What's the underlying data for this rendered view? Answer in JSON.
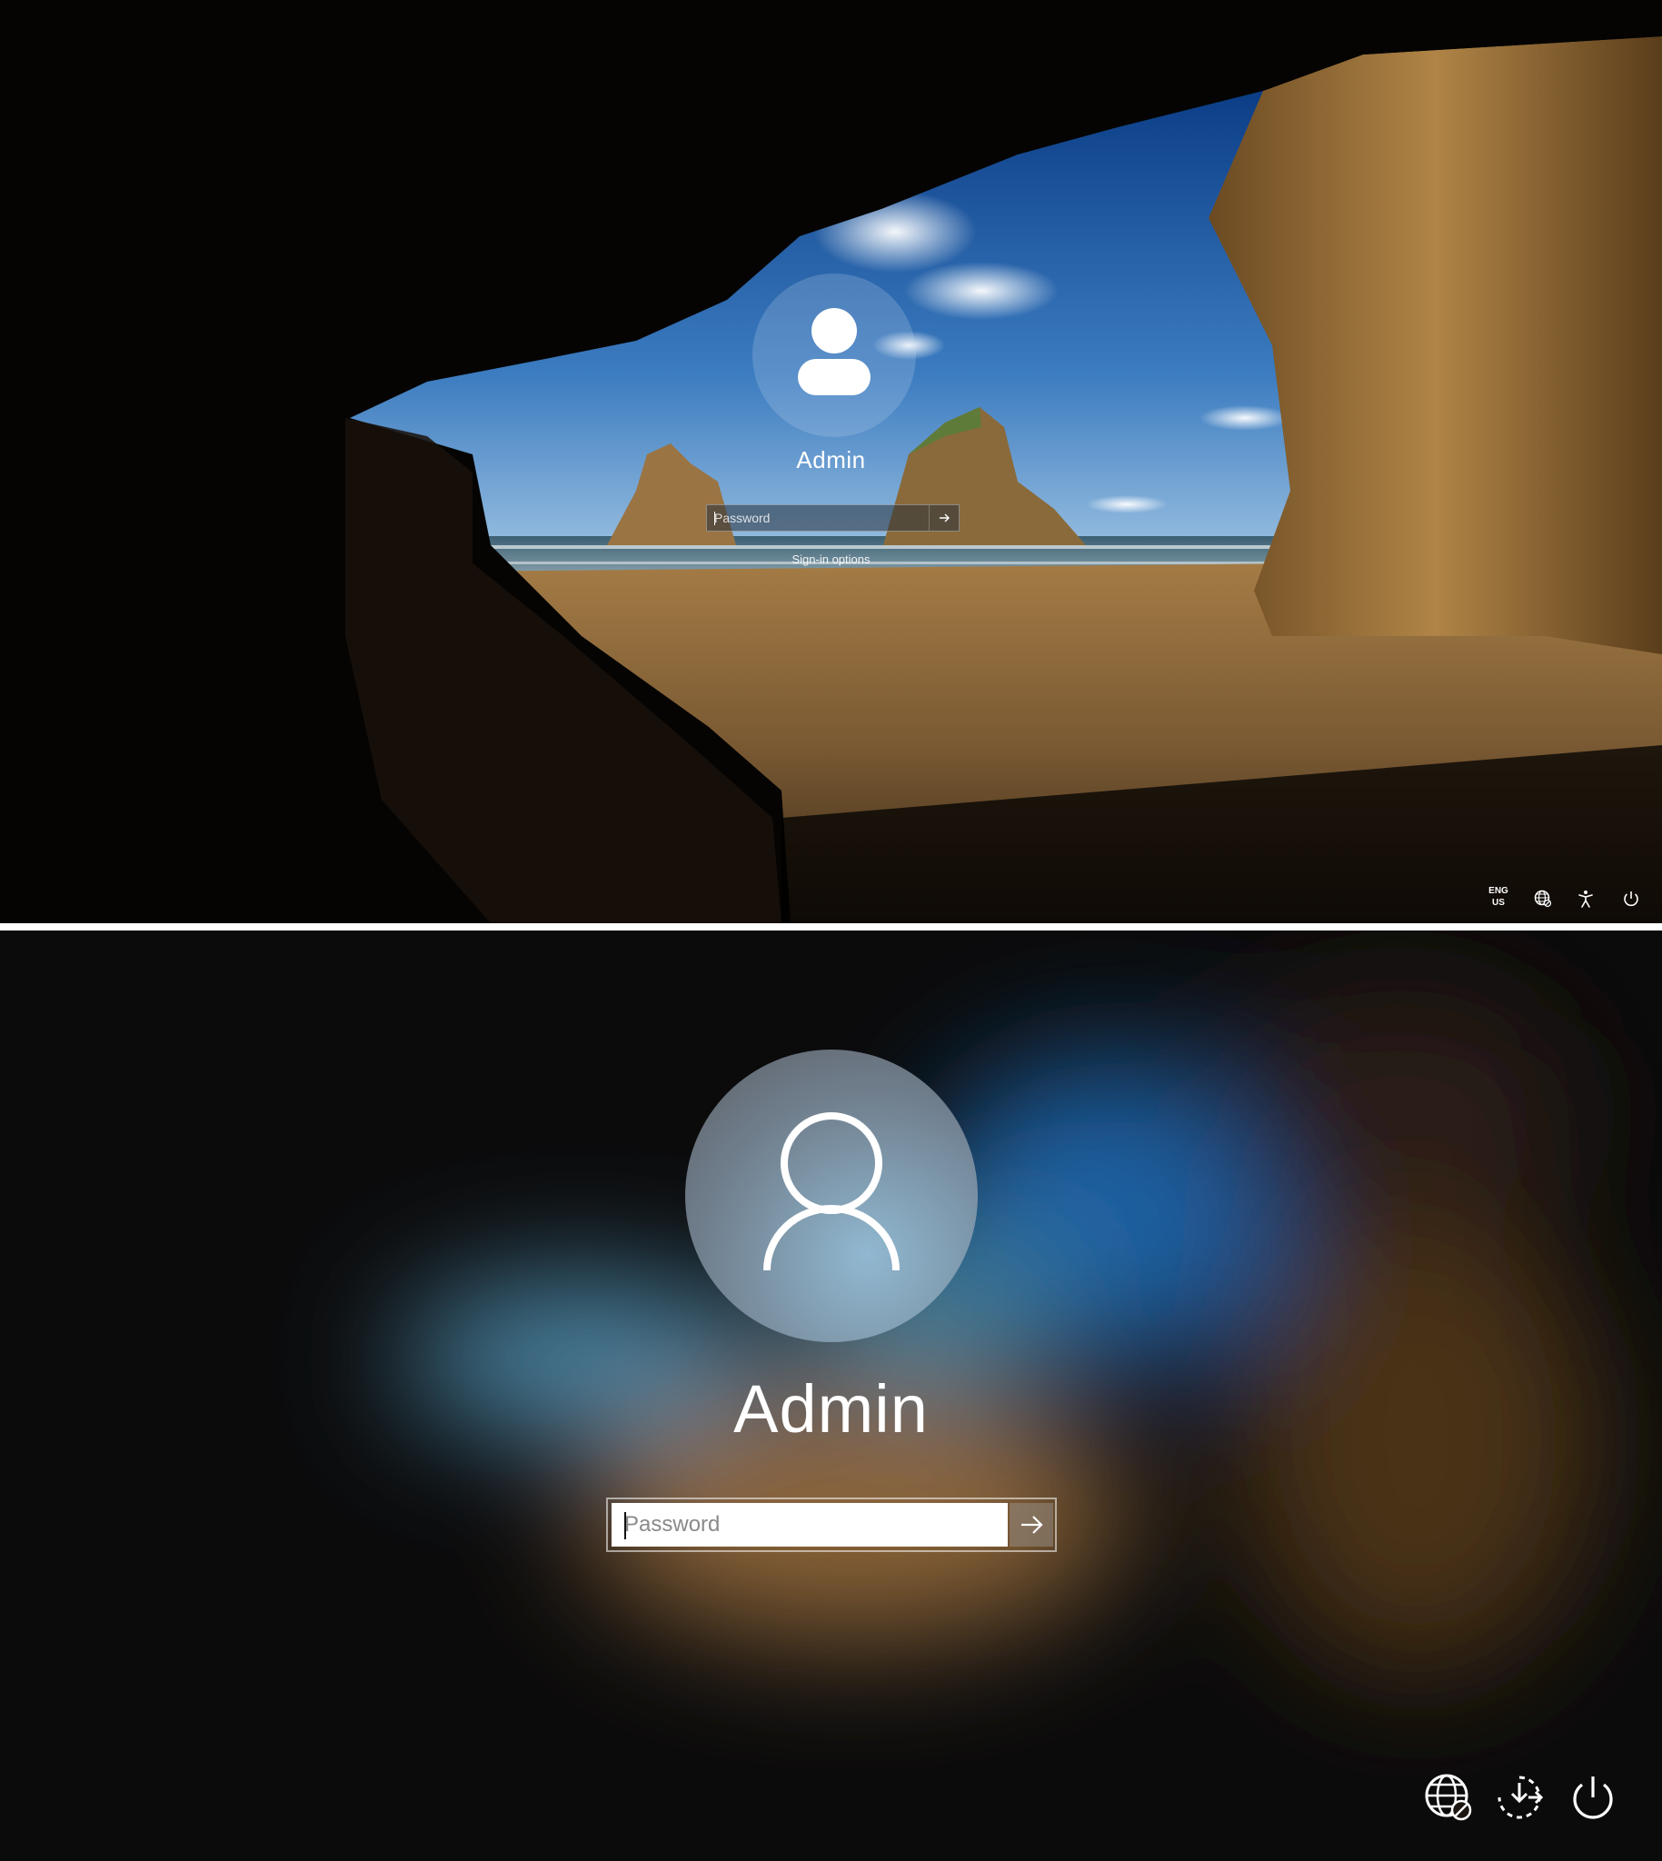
{
  "top_screen": {
    "username": "Admin",
    "password_placeholder": "Password",
    "signin_options": "Sign-in options",
    "language": {
      "line1": "ENG",
      "line2": "US"
    },
    "tray_icons": [
      "network-icon",
      "accessibility-icon",
      "power-icon"
    ]
  },
  "bottom_screen": {
    "username": "Admin",
    "password_placeholder": "Password",
    "tray_icons": [
      "network-icon",
      "ease-of-access-icon",
      "power-icon"
    ]
  },
  "colors": {
    "sky": "#2f6fb0",
    "sand": "#a0773f",
    "cave": "#050505",
    "text": "#ffffff"
  }
}
